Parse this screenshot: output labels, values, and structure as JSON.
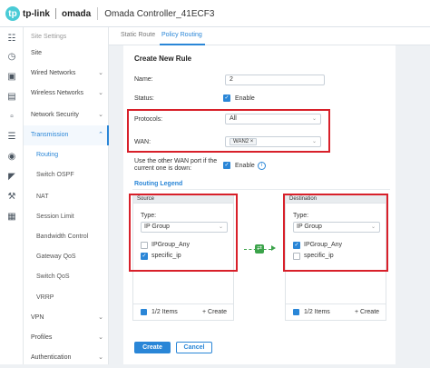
{
  "header": {
    "logo_mark": "tp",
    "brand": "tp-link",
    "product": "omada",
    "title": "Omada Controller_41ECF3"
  },
  "rail": {
    "icons": [
      "grid-icon",
      "clock-icon",
      "map-icon",
      "stats-icon",
      "device-icon",
      "clients-icon",
      "location-icon",
      "history-icon",
      "tools-icon",
      "org-icon"
    ]
  },
  "sidebar": {
    "items": [
      {
        "label": "Site Settings"
      },
      {
        "label": "Site"
      },
      {
        "label": "Wired Networks"
      },
      {
        "label": "Wireless Networks"
      },
      {
        "label": "Network Security"
      },
      {
        "label": "Transmission"
      },
      {
        "label": "Routing"
      },
      {
        "label": "Switch OSPF"
      },
      {
        "label": "NAT"
      },
      {
        "label": "Session Limit"
      },
      {
        "label": "Bandwidth Control"
      },
      {
        "label": "Gateway QoS"
      },
      {
        "label": "Switch QoS"
      },
      {
        "label": "VRRP"
      },
      {
        "label": "VPN"
      },
      {
        "label": "Profiles"
      },
      {
        "label": "Authentication"
      }
    ]
  },
  "tabs": [
    {
      "label": "Static Route"
    },
    {
      "label": "Policy Routing"
    }
  ],
  "form": {
    "title": "Create New Rule",
    "name_label": "Name:",
    "name_value": "2",
    "status_label": "Status:",
    "status_option": "Enable",
    "protocols_label": "Protocols:",
    "protocols_value": "All",
    "wan_label": "WAN:",
    "wan_value": "WAN2",
    "failover_label_1": "Use the other WAN port if the",
    "failover_label_2": "current one is down:",
    "failover_option": "Enable",
    "legend_label": "Routing Legend"
  },
  "source": {
    "title": "Source",
    "type_label": "Type:",
    "type_value": "IP Group",
    "items": [
      {
        "label": "IPGroup_Any",
        "checked": false
      },
      {
        "label": "specific_ip",
        "checked": true
      }
    ],
    "count": "1/2 Items",
    "create": "+ Create"
  },
  "destination": {
    "title": "Destination",
    "type_label": "Type:",
    "type_value": "IP Group",
    "items": [
      {
        "label": "IPGroup_Any",
        "checked": true
      },
      {
        "label": "specific_ip",
        "checked": false
      }
    ],
    "count": "1/2 Items",
    "create": "+ Create"
  },
  "actions": {
    "create": "Create",
    "cancel": "Cancel"
  },
  "colors": {
    "accent": "#2a86d7",
    "highlight": "#d8202a",
    "connector": "#3ba34a"
  }
}
